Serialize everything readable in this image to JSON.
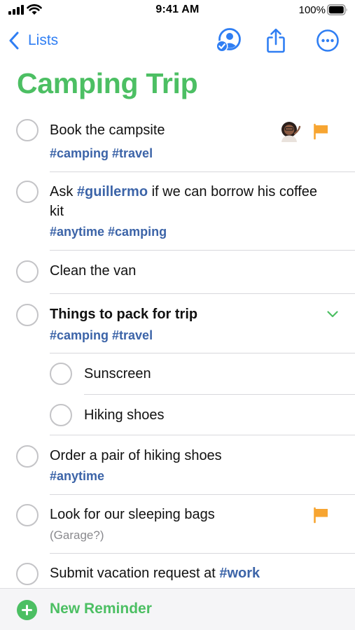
{
  "status_bar": {
    "time": "9:41 AM",
    "battery_percent": "100%",
    "battery_level": 1.0
  },
  "nav": {
    "back_label": "Lists",
    "icons": [
      "chevron-left-icon",
      "share-with-people-icon",
      "share-icon",
      "more-icon"
    ]
  },
  "list": {
    "title": "Camping Trip",
    "accent_color": "#4cbf63",
    "tag_color": "#3c64a8",
    "flag_color": "#f7a531"
  },
  "reminders": [
    {
      "title": "Book the campsite",
      "tags": "#camping #travel",
      "assigned": true,
      "flagged": true
    },
    {
      "title_before": "Ask ",
      "title_tag": "#guillermo",
      "title_after_line1": " if we can borrow his coffee",
      "title_line2": "kit",
      "tags": "#anytime #camping"
    },
    {
      "title": "Clean the van"
    },
    {
      "title": "Things to pack for trip",
      "tags": "#camping #travel",
      "expanded": true,
      "subtasks": [
        {
          "title": "Sunscreen"
        },
        {
          "title": "Hiking shoes"
        }
      ]
    },
    {
      "title": "Order a pair of hiking shoes",
      "tags": "#anytime"
    },
    {
      "title": "Look for our sleeping bags",
      "note": "(Garage?)",
      "flagged": true
    },
    {
      "title_before": "Submit vacation request at ",
      "title_tag": "#work"
    }
  ],
  "bottom_bar": {
    "new_reminder_label": "New Reminder"
  }
}
